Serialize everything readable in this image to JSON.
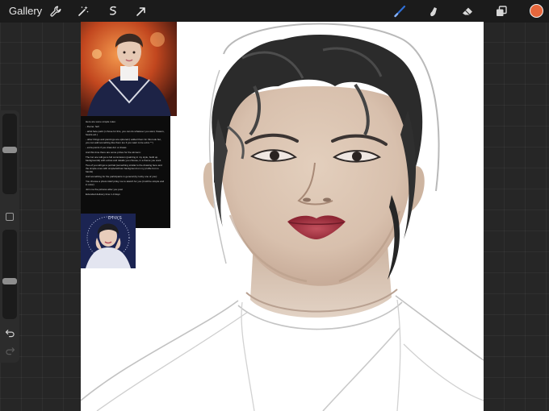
{
  "toolbar": {
    "gallery_label": "Gallery",
    "left_tools": [
      "wrench-icon",
      "magic-wand-icon",
      "selection-icon",
      "transform-arrow-icon"
    ],
    "right_tools": [
      "brush-icon",
      "smudge-icon",
      "eraser-icon",
      "layers-icon"
    ],
    "brush_color": "#2f6fd6",
    "active_color": "#e7673c"
  },
  "sidebar": {
    "brush_size_level": 0.55,
    "opacity_level": 0.42
  },
  "reference": {
    "lines": [
      "Here are some simple rules:",
      "- theme: hell",
      "- artist face paint (i chose for this, you can do whatever you want, flowers, hearts etc.)",
      "- other things and piercings are optional (i added them for this look but, you can add something like them too if you want to be extra ^^)",
      "- extra points if you draw dcc or draws",
      "And this time there are some prizes for the winners:",
      "The 1st one will get a full commission (painting in my style, build up, backgrounds) with extras and details you choose, in a theme you want",
      "Two of you will get a portrait (something similar to the drawing here and the simple ones with simple/without background on my profile but no hands)",
      "And something for the participants in general (by lucky one of you):",
      "You choose a photo /idol/ pinky me to sketch for you (it will be simple and in color)",
      "Join me the pictures after you post",
      "Extended delivery time 1-3 days"
    ],
    "caption": "DTIYS"
  },
  "colors": {
    "toolbar_bg": "#1b1b1b",
    "workspace_bg": "#262626",
    "canvas_bg": "#ffffff",
    "lip_color": "#a8303e",
    "hair_color": "#2b2b2b",
    "skin_color": "#ddc8b6"
  }
}
